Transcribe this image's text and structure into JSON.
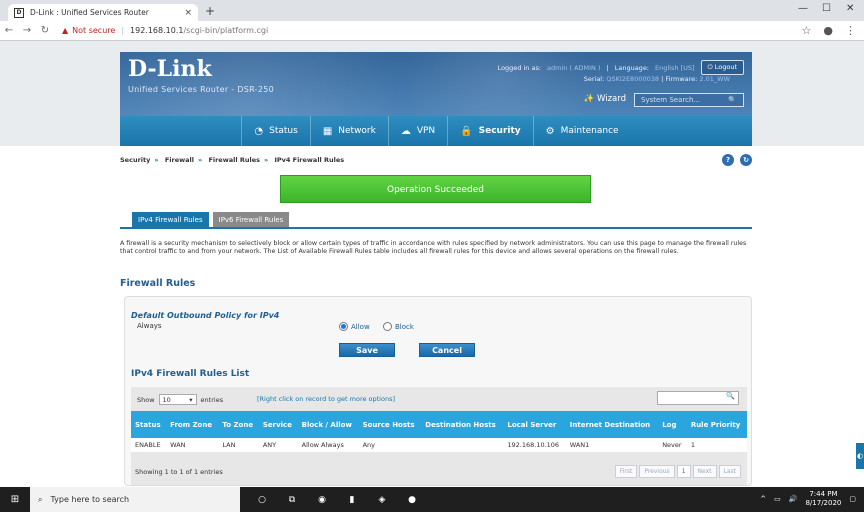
{
  "browser": {
    "tab_title": "D-Link : Unified Services Router",
    "tab_close": "×",
    "new_tab": "+",
    "favicon_text": "D",
    "url_warning": "Not secure",
    "url_host": "192.168.10.1",
    "url_path": "/scgi-bin/platform.cgi",
    "win_min": "—",
    "win_max": "☐",
    "win_close": "✕"
  },
  "router": {
    "logo": "D-Link",
    "product": "Unified Services Router - DSR-250",
    "logged_in_label": "Logged in as:",
    "logged_in_value": "admin ( ADMIN )",
    "language_label": "Language:",
    "language_value": "English [US]",
    "logout_label": "Logout",
    "serial_label": "Serial:",
    "serial_value": "QSKI2E8000038",
    "firmware_label": "Firmware:",
    "firmware_value": "2.01_WW",
    "wizard_label": "Wizard",
    "system_search_placeholder": "System Search..."
  },
  "nav": {
    "items": [
      {
        "label": "Status",
        "icon": "dashboard-icon"
      },
      {
        "label": "Network",
        "icon": "network-icon"
      },
      {
        "label": "VPN",
        "icon": "cloud-icon"
      },
      {
        "label": "Security",
        "icon": "lock-icon"
      },
      {
        "label": "Maintenance",
        "icon": "gear-icon"
      }
    ],
    "active": "Security"
  },
  "breadcrumb": [
    "Security",
    "Firewall",
    "Firewall Rules",
    "IPv4 Firewall Rules"
  ],
  "success_message": "Operation Succeeded",
  "tabs": [
    "IPv4 Firewall Rules",
    "IPv6 Firewall Rules"
  ],
  "description": "A firewall is a security mechanism to selectively block or allow certain types of traffic in accordance with rules specified by network administrators. You can use this page to manage the firewall rules that control traffic to and from your network. The List of Available Firewall Rules table includes all firewall rules for this device and allows several operations on the firewall rules.",
  "section_title": "Firewall Rules",
  "policy": {
    "title": "Default Outbound Policy for IPv4",
    "subtitle": "Always",
    "options": [
      "Allow",
      "Block"
    ],
    "selected": "Allow",
    "save_label": "Save",
    "cancel_label": "Cancel"
  },
  "list": {
    "title": "IPv4 Firewall Rules List",
    "show_label": "Show",
    "entries_value": "10",
    "entries_label": "entries",
    "hint": "[Right click on record to get more options]",
    "columns": [
      "Status",
      "From Zone",
      "To Zone",
      "Service",
      "Block / Allow",
      "Source Hosts",
      "Destination Hosts",
      "Local Server",
      "Internet Destination",
      "Log",
      "Rule Priority"
    ],
    "rows": [
      [
        "ENABLE",
        "WAN",
        "LAN",
        "ANY",
        "Allow Always",
        "Any",
        "",
        "192.168.10.106",
        "WAN1",
        "Never",
        "1"
      ]
    ],
    "footer": "Showing 1 to 1 of 1 entries",
    "pager": [
      "First",
      "Previous",
      "1",
      "Next",
      "Last"
    ]
  },
  "taskbar": {
    "search_placeholder": "Type here to search",
    "time": "7:44 PM",
    "date": "8/17/2020"
  }
}
